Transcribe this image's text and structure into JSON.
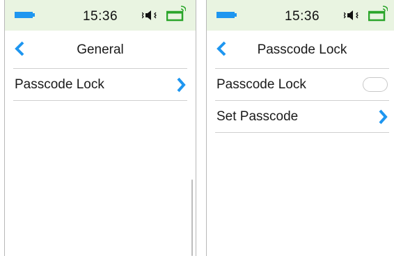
{
  "accent_color": "#1e96f0",
  "statusbar_color": "#e9f4e1",
  "screens": [
    {
      "status": {
        "time": "15:36",
        "icons": [
          "battery-icon",
          "sound-icon",
          "signal-icon"
        ]
      },
      "nav": {
        "title": "General",
        "back_icon": "chevron-left-icon"
      },
      "items": [
        {
          "label": "Passcode Lock",
          "control": "chevron-right-icon"
        }
      ]
    },
    {
      "status": {
        "time": "15:36",
        "icons": [
          "battery-icon",
          "sound-icon",
          "signal-icon"
        ]
      },
      "nav": {
        "title": "Passcode Lock",
        "back_icon": "chevron-left-icon"
      },
      "items": [
        {
          "label": "Passcode Lock",
          "control": "toggle",
          "toggle_state": "off"
        },
        {
          "label": "Set Passcode",
          "control": "chevron-right-icon"
        }
      ]
    }
  ]
}
